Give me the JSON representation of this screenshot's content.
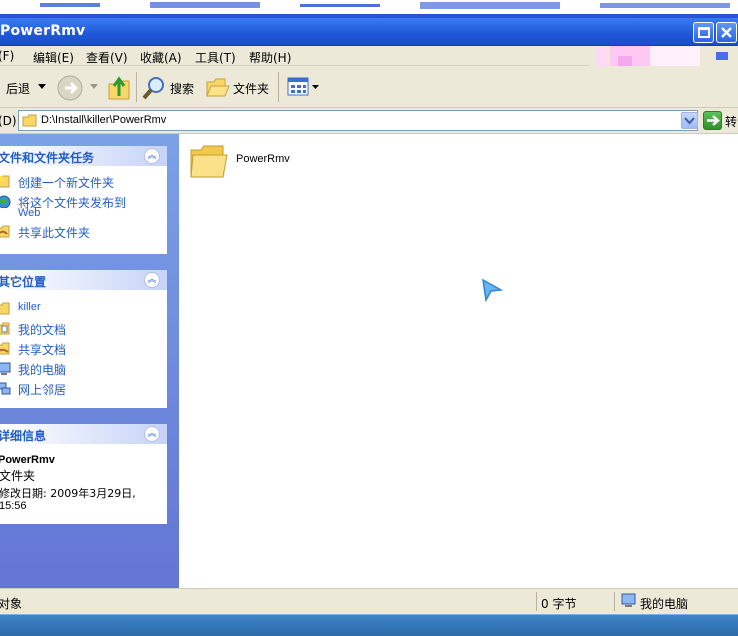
{
  "window": {
    "title": "PowerRmv"
  },
  "menu": [
    {
      "label": "(F)"
    },
    {
      "label": "编辑(E)"
    },
    {
      "label": "查看(V)"
    },
    {
      "label": "收藏(A)"
    },
    {
      "label": "工具(T)"
    },
    {
      "label": "帮助(H)"
    }
  ],
  "toolbar": {
    "back_label": "后退",
    "search_label": "搜索",
    "folders_label": "文件夹"
  },
  "address": {
    "label": "(D)",
    "value": "D:\\Install\\killer\\PowerRmv",
    "go_label": "转"
  },
  "tasks_panel": {
    "title": "文件和文件夹任务",
    "items": [
      {
        "label": "创建一个新文件夹",
        "icon": "new-folder-icon"
      },
      {
        "label": "将这个文件夹发布到",
        "label2": "Web",
        "icon": "publish-web-icon"
      },
      {
        "label": "共享此文件夹",
        "icon": "share-folder-icon"
      }
    ]
  },
  "places_panel": {
    "title": "其它位置",
    "items": [
      {
        "label": "killer",
        "icon": "folder-icon"
      },
      {
        "label": "我的文档",
        "icon": "my-documents-icon"
      },
      {
        "label": "共享文档",
        "icon": "shared-documents-icon"
      },
      {
        "label": "我的电脑",
        "icon": "my-computer-icon"
      },
      {
        "label": "网上邻居",
        "icon": "network-places-icon"
      }
    ]
  },
  "details_panel": {
    "title": "详细信息",
    "name": "PowerRmv",
    "type": "文件夹",
    "modified_line1": "修改日期: 2009年3月29日,",
    "modified_line2": "15:56"
  },
  "files": [
    {
      "name": "PowerRmv",
      "icon": "folder-icon"
    }
  ],
  "status": {
    "objects": "对象",
    "size": "0 字节",
    "location": "我的电脑"
  },
  "colors": {
    "titlebar": "#1f57d8",
    "task_pane": "#6f8ee0",
    "panel_text": "#215dc6",
    "chrome": "#ece9d8"
  }
}
